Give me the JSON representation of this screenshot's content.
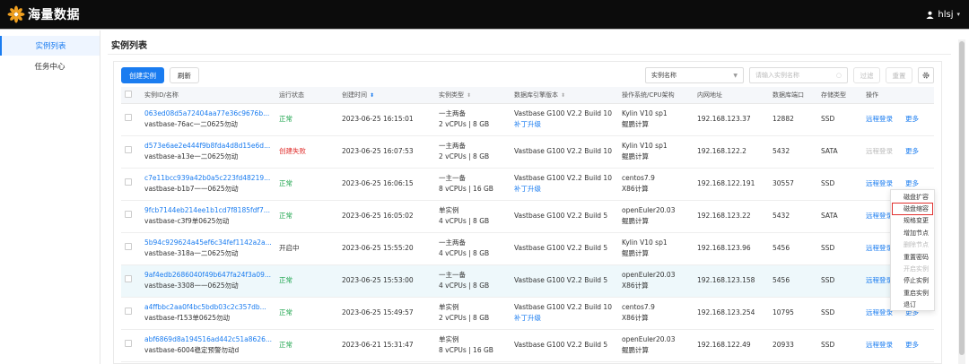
{
  "app": {
    "title": "海量数据",
    "user": "hlsj"
  },
  "sidebar": {
    "items": [
      {
        "label": "实例列表"
      },
      {
        "label": "任务中心"
      }
    ]
  },
  "page": {
    "title": "实例列表"
  },
  "toolbar": {
    "create_label": "创建实例",
    "refresh_label": "刷新",
    "filter_select": "实例名称",
    "search_placeholder": "请输入实例名称",
    "filter_label": "过滤",
    "reset_label": "重置"
  },
  "table": {
    "headers": {
      "id": "实例ID/名称",
      "status": "运行状态",
      "created": "创建时间",
      "type": "实例类型",
      "engine": "数据库引擎版本",
      "os": "操作系统/CPU架构",
      "ip": "内网地址",
      "port": "数据库端口",
      "storage": "存储类型",
      "ops": "操作"
    },
    "rows": [
      {
        "id": "063ed08d5a72404aa77e36c9676b...",
        "name": "vastbase-76ac一二0625勿动",
        "status": "正常",
        "status_kind": "ok",
        "created": "2023-06-25 16:15:01",
        "type1": "一主两备",
        "type2": "2 vCPUs | 8 GB",
        "engine": "Vastbase G100 V2.2 Build 10",
        "engine_sub": "补丁升级",
        "os1": "Kylin V10 sp1",
        "os2": "鲲鹏计算",
        "ip": "192.168.123.37",
        "port": "12882",
        "storage": "SSD",
        "op1": "远程登录",
        "op1_disabled": false,
        "op2": "更多"
      },
      {
        "id": "d573e6ae2e444f9b8fda4d8d15e6d...",
        "name": "vastbase-a13e一二0625勿动",
        "status": "创建失败",
        "status_kind": "fail",
        "created": "2023-06-25 16:07:53",
        "type1": "一主两备",
        "type2": "2 vCPUs | 8 GB",
        "engine": "Vastbase G100 V2.2 Build 10",
        "engine_sub": "",
        "os1": "Kylin V10 sp1",
        "os2": "鲲鹏计算",
        "ip": "192.168.122.2",
        "port": "5432",
        "storage": "SATA",
        "op1": "远程登录",
        "op1_disabled": true,
        "op2": "更多"
      },
      {
        "id": "c7e11bcc939a42b0a5c223fd48219...",
        "name": "vastbase-b1b7一一0625勿动",
        "status": "正常",
        "status_kind": "ok",
        "created": "2023-06-25 16:06:15",
        "type1": "一主一备",
        "type2": "8 vCPUs | 16 GB",
        "engine": "Vastbase G100 V2.2 Build 10",
        "engine_sub": "补丁升级",
        "os1": "centos7.9",
        "os2": "X86计算",
        "ip": "192.168.122.191",
        "port": "30557",
        "storage": "SSD",
        "op1": "远程登录",
        "op1_disabled": false,
        "op2": "更多"
      },
      {
        "id": "9fcb7144eb214ee1b1cd7f8185fdf7...",
        "name": "vastbase-c3f9单0625勿动",
        "status": "正常",
        "status_kind": "ok",
        "created": "2023-06-25 16:05:02",
        "type1": "单实例",
        "type2": "4 vCPUs | 8 GB",
        "engine": "Vastbase G100 V2.2 Build 5",
        "engine_sub": "",
        "os1": "openEuler20.03",
        "os2": "鲲鹏计算",
        "ip": "192.168.123.22",
        "port": "5432",
        "storage": "SATA",
        "op1": "远程登录",
        "op1_disabled": false,
        "op2": "更多"
      },
      {
        "id": "5b94c929624a45ef6c34fef1142a2a...",
        "name": "vastbase-318a一二0625勿动",
        "status": "开启中",
        "status_kind": "start",
        "created": "2023-06-25 15:55:20",
        "type1": "一主两备",
        "type2": "4 vCPUs | 8 GB",
        "engine": "Vastbase G100 V2.2 Build 5",
        "engine_sub": "",
        "os1": "Kylin V10 sp1",
        "os2": "鲲鹏计算",
        "ip": "192.168.123.96",
        "port": "5456",
        "storage": "SSD",
        "op1": "远程登录",
        "op1_disabled": false,
        "op2": "更多"
      },
      {
        "id": "9af4edb2686040f49b647fa24f3a09...",
        "name": "vastbase-3308一一0625勿动",
        "status": "正常",
        "status_kind": "ok",
        "created": "2023-06-25 15:53:00",
        "type1": "一主一备",
        "type2": "4 vCPUs | 8 GB",
        "engine": "Vastbase G100 V2.2 Build 5",
        "engine_sub": "",
        "os1": "openEuler20.03",
        "os2": "X86计算",
        "ip": "192.168.123.158",
        "port": "5456",
        "storage": "SSD",
        "op1": "远程登录",
        "op1_disabled": false,
        "op2": "更多",
        "highlight": true
      },
      {
        "id": "a4ffbbc2aa0f4bc5bdb03c2c357db...",
        "name": "vastbase-f153单0625勿动",
        "status": "正常",
        "status_kind": "ok",
        "created": "2023-06-25 15:49:57",
        "type1": "单实例",
        "type2": "2 vCPUs | 8 GB",
        "engine": "Vastbase G100 V2.2 Build 10",
        "engine_sub": "补丁升级",
        "os1": "centos7.9",
        "os2": "X86计算",
        "ip": "192.168.123.254",
        "port": "10795",
        "storage": "SSD",
        "op1": "远程登录",
        "op1_disabled": false,
        "op2": "更多"
      },
      {
        "id": "abf6869d8a194516ad442c51a8626...",
        "name": "vastbase-6004稳定预警勿动d",
        "status": "正常",
        "status_kind": "ok",
        "created": "2023-06-21 15:31:47",
        "type1": "单实例",
        "type2": "8 vCPUs | 16 GB",
        "engine": "Vastbase G100 V2.2 Build 5",
        "engine_sub": "",
        "os1": "openEuler20.03",
        "os2": "鲲鹏计算",
        "ip": "192.168.122.49",
        "port": "20933",
        "storage": "SSD",
        "op1": "远程登录",
        "op1_disabled": false,
        "op2": "更多"
      }
    ]
  },
  "more_menu": {
    "items": [
      {
        "label": "磁盘扩容",
        "disabled": false,
        "highlight": false
      },
      {
        "label": "磁盘缩容",
        "disabled": false,
        "highlight": true
      },
      {
        "label": "规格变更",
        "disabled": false,
        "highlight": false
      },
      {
        "label": "增加节点",
        "disabled": false,
        "highlight": false
      },
      {
        "label": "删除节点",
        "disabled": true,
        "highlight": false
      },
      {
        "label": "重置密码",
        "disabled": false,
        "highlight": false
      },
      {
        "label": "开启实例",
        "disabled": true,
        "highlight": false
      },
      {
        "label": "停止实例",
        "disabled": false,
        "highlight": false
      },
      {
        "label": "重启实例",
        "disabled": false,
        "highlight": false
      },
      {
        "label": "退订",
        "disabled": false,
        "highlight": false
      }
    ]
  },
  "colors": {
    "accent": "#1a7cf0",
    "ok": "#19a34a",
    "fail": "#e0302e",
    "highlight_row": "#eef8fb"
  },
  "icons": {
    "logo": "logo-flower-icon",
    "user": "user-icon",
    "settings": "gear-icon",
    "sort": "sort-icon",
    "clear": "clear-icon"
  }
}
